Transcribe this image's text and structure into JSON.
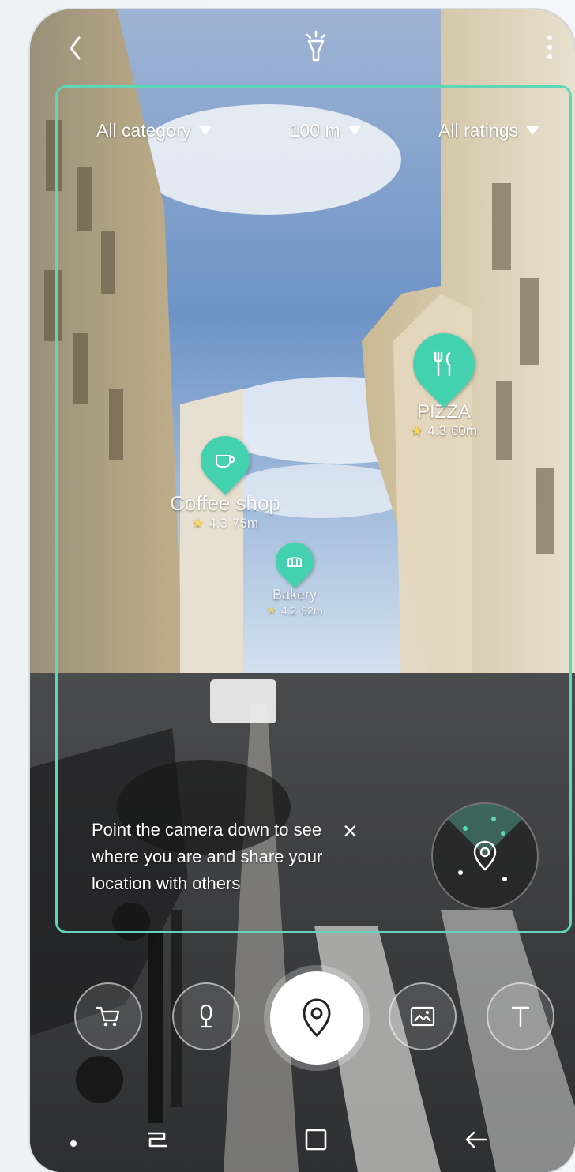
{
  "filters": {
    "category": "All category",
    "distance": "100 m",
    "ratings": "All ratings"
  },
  "pois": [
    {
      "name": "Coffee shop",
      "rating": "4.3",
      "distance": "75m",
      "icon": "coffee-cup-icon"
    },
    {
      "name": "PIZZA",
      "rating": "4.3",
      "distance": "60m",
      "icon": "fork-knife-icon"
    },
    {
      "name": "Bakery",
      "rating": "4.2",
      "distance": "92m",
      "icon": "bread-icon"
    }
  ],
  "hint": {
    "text": "Point the camera down to see where you are and share your location with others"
  },
  "toolbar": {
    "buttons": [
      "cart-icon",
      "microphone-icon",
      "location-pin-icon",
      "image-icon",
      "text-icon"
    ]
  },
  "colors": {
    "accent": "#5fd6b8",
    "pin": "#43d1b0",
    "star": "#ffd64c"
  }
}
